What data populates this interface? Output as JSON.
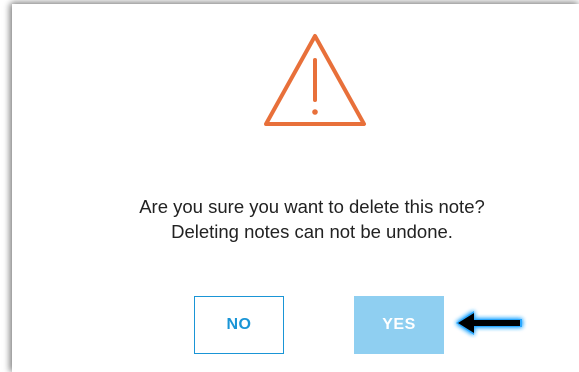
{
  "dialog": {
    "icon": "warning-triangle-icon",
    "message_line1": "Are you sure you want to delete this note?",
    "message_line2": "Deleting notes can not be undone.",
    "no_label": "NO",
    "yes_label": "YES"
  },
  "colors": {
    "warning": "#e8703a",
    "primary": "#1a95d6",
    "yes_background": "#8fcff1",
    "annotation_arrow": "#000000",
    "annotation_glow": "#2aa8ff"
  },
  "annotation": {
    "icon": "left-arrow-icon"
  }
}
